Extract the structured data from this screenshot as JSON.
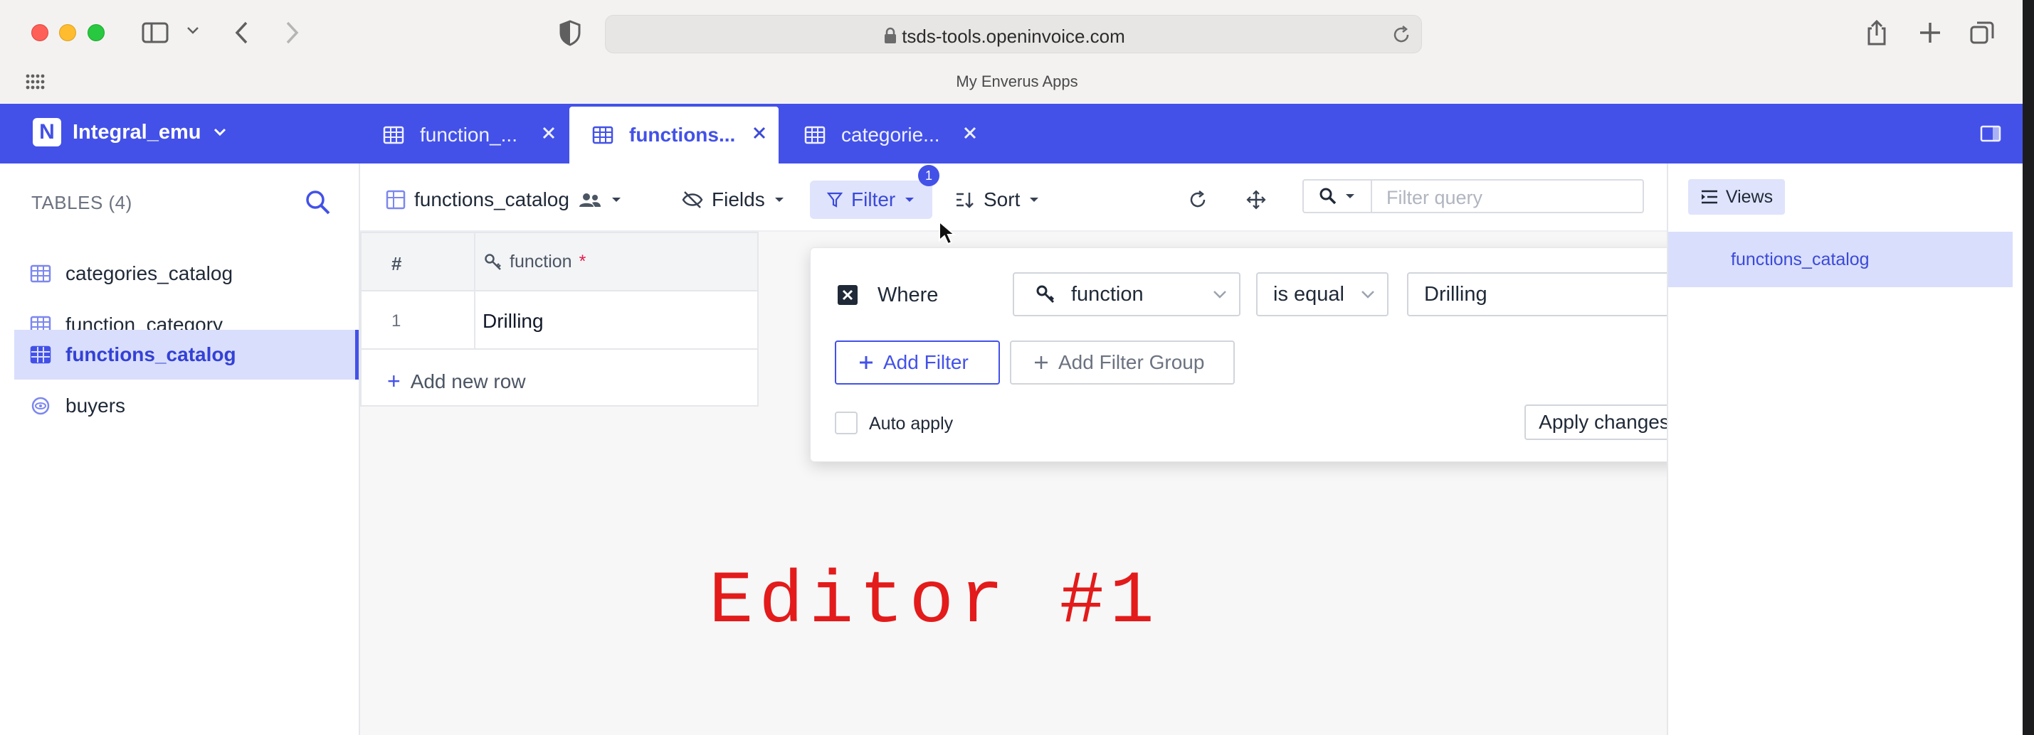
{
  "browser": {
    "url": "tsds-tools.openinvoice.com",
    "favorites_title": "My Enverus Apps"
  },
  "app": {
    "workspace": "Integral_emu",
    "tabs": [
      {
        "label": "function_..."
      },
      {
        "label": "functions..."
      },
      {
        "label": "categorie..."
      }
    ]
  },
  "sidebar": {
    "title": "TABLES (4)",
    "items": [
      {
        "label": "categories_catalog"
      },
      {
        "label": "function_category"
      },
      {
        "label": "functions_catalog"
      },
      {
        "label": "buyers"
      }
    ]
  },
  "toolbar": {
    "table_name": "functions_catalog",
    "fields_label": "Fields",
    "filter_label": "Filter",
    "filter_count": "1",
    "sort_label": "Sort",
    "search_placeholder": "Filter query"
  },
  "grid": {
    "row_header": "#",
    "columns": [
      {
        "label": "function",
        "required_mark": "*"
      }
    ],
    "rows": [
      {
        "num": "1",
        "cells": [
          "Drilling"
        ]
      }
    ],
    "add_row_label": "Add new row"
  },
  "filter_popover": {
    "where_label": "Where",
    "field": "function",
    "operator": "is equal",
    "value": "Drilling",
    "add_filter_label": "Add Filter",
    "add_group_label": "Add Filter Group",
    "auto_apply_label": "Auto apply",
    "apply_label": "Apply changes"
  },
  "views": {
    "button_label": "Views",
    "items": [
      {
        "label": "functions_catalog"
      }
    ]
  },
  "overlay_text": "Editor #1",
  "colors": {
    "accent": "#4351e8",
    "active_bg": "#d9defc",
    "annotation": "#e31b1b"
  }
}
